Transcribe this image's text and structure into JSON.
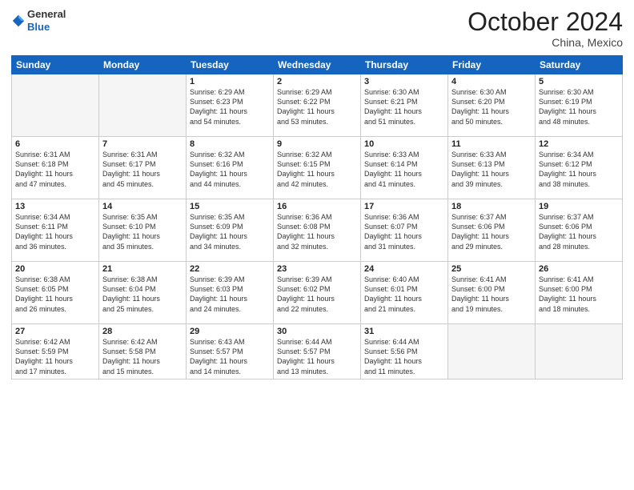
{
  "header": {
    "logo_line1": "General",
    "logo_line2": "Blue",
    "month_title": "October 2024",
    "location": "China, Mexico"
  },
  "days_of_week": [
    "Sunday",
    "Monday",
    "Tuesday",
    "Wednesday",
    "Thursday",
    "Friday",
    "Saturday"
  ],
  "weeks": [
    [
      {
        "num": "",
        "info": ""
      },
      {
        "num": "",
        "info": ""
      },
      {
        "num": "1",
        "info": "Sunrise: 6:29 AM\nSunset: 6:23 PM\nDaylight: 11 hours\nand 54 minutes."
      },
      {
        "num": "2",
        "info": "Sunrise: 6:29 AM\nSunset: 6:22 PM\nDaylight: 11 hours\nand 53 minutes."
      },
      {
        "num": "3",
        "info": "Sunrise: 6:30 AM\nSunset: 6:21 PM\nDaylight: 11 hours\nand 51 minutes."
      },
      {
        "num": "4",
        "info": "Sunrise: 6:30 AM\nSunset: 6:20 PM\nDaylight: 11 hours\nand 50 minutes."
      },
      {
        "num": "5",
        "info": "Sunrise: 6:30 AM\nSunset: 6:19 PM\nDaylight: 11 hours\nand 48 minutes."
      }
    ],
    [
      {
        "num": "6",
        "info": "Sunrise: 6:31 AM\nSunset: 6:18 PM\nDaylight: 11 hours\nand 47 minutes."
      },
      {
        "num": "7",
        "info": "Sunrise: 6:31 AM\nSunset: 6:17 PM\nDaylight: 11 hours\nand 45 minutes."
      },
      {
        "num": "8",
        "info": "Sunrise: 6:32 AM\nSunset: 6:16 PM\nDaylight: 11 hours\nand 44 minutes."
      },
      {
        "num": "9",
        "info": "Sunrise: 6:32 AM\nSunset: 6:15 PM\nDaylight: 11 hours\nand 42 minutes."
      },
      {
        "num": "10",
        "info": "Sunrise: 6:33 AM\nSunset: 6:14 PM\nDaylight: 11 hours\nand 41 minutes."
      },
      {
        "num": "11",
        "info": "Sunrise: 6:33 AM\nSunset: 6:13 PM\nDaylight: 11 hours\nand 39 minutes."
      },
      {
        "num": "12",
        "info": "Sunrise: 6:34 AM\nSunset: 6:12 PM\nDaylight: 11 hours\nand 38 minutes."
      }
    ],
    [
      {
        "num": "13",
        "info": "Sunrise: 6:34 AM\nSunset: 6:11 PM\nDaylight: 11 hours\nand 36 minutes."
      },
      {
        "num": "14",
        "info": "Sunrise: 6:35 AM\nSunset: 6:10 PM\nDaylight: 11 hours\nand 35 minutes."
      },
      {
        "num": "15",
        "info": "Sunrise: 6:35 AM\nSunset: 6:09 PM\nDaylight: 11 hours\nand 34 minutes."
      },
      {
        "num": "16",
        "info": "Sunrise: 6:36 AM\nSunset: 6:08 PM\nDaylight: 11 hours\nand 32 minutes."
      },
      {
        "num": "17",
        "info": "Sunrise: 6:36 AM\nSunset: 6:07 PM\nDaylight: 11 hours\nand 31 minutes."
      },
      {
        "num": "18",
        "info": "Sunrise: 6:37 AM\nSunset: 6:06 PM\nDaylight: 11 hours\nand 29 minutes."
      },
      {
        "num": "19",
        "info": "Sunrise: 6:37 AM\nSunset: 6:06 PM\nDaylight: 11 hours\nand 28 minutes."
      }
    ],
    [
      {
        "num": "20",
        "info": "Sunrise: 6:38 AM\nSunset: 6:05 PM\nDaylight: 11 hours\nand 26 minutes."
      },
      {
        "num": "21",
        "info": "Sunrise: 6:38 AM\nSunset: 6:04 PM\nDaylight: 11 hours\nand 25 minutes."
      },
      {
        "num": "22",
        "info": "Sunrise: 6:39 AM\nSunset: 6:03 PM\nDaylight: 11 hours\nand 24 minutes."
      },
      {
        "num": "23",
        "info": "Sunrise: 6:39 AM\nSunset: 6:02 PM\nDaylight: 11 hours\nand 22 minutes."
      },
      {
        "num": "24",
        "info": "Sunrise: 6:40 AM\nSunset: 6:01 PM\nDaylight: 11 hours\nand 21 minutes."
      },
      {
        "num": "25",
        "info": "Sunrise: 6:41 AM\nSunset: 6:00 PM\nDaylight: 11 hours\nand 19 minutes."
      },
      {
        "num": "26",
        "info": "Sunrise: 6:41 AM\nSunset: 6:00 PM\nDaylight: 11 hours\nand 18 minutes."
      }
    ],
    [
      {
        "num": "27",
        "info": "Sunrise: 6:42 AM\nSunset: 5:59 PM\nDaylight: 11 hours\nand 17 minutes."
      },
      {
        "num": "28",
        "info": "Sunrise: 6:42 AM\nSunset: 5:58 PM\nDaylight: 11 hours\nand 15 minutes."
      },
      {
        "num": "29",
        "info": "Sunrise: 6:43 AM\nSunset: 5:57 PM\nDaylight: 11 hours\nand 14 minutes."
      },
      {
        "num": "30",
        "info": "Sunrise: 6:44 AM\nSunset: 5:57 PM\nDaylight: 11 hours\nand 13 minutes."
      },
      {
        "num": "31",
        "info": "Sunrise: 6:44 AM\nSunset: 5:56 PM\nDaylight: 11 hours\nand 11 minutes."
      },
      {
        "num": "",
        "info": ""
      },
      {
        "num": "",
        "info": ""
      }
    ]
  ]
}
